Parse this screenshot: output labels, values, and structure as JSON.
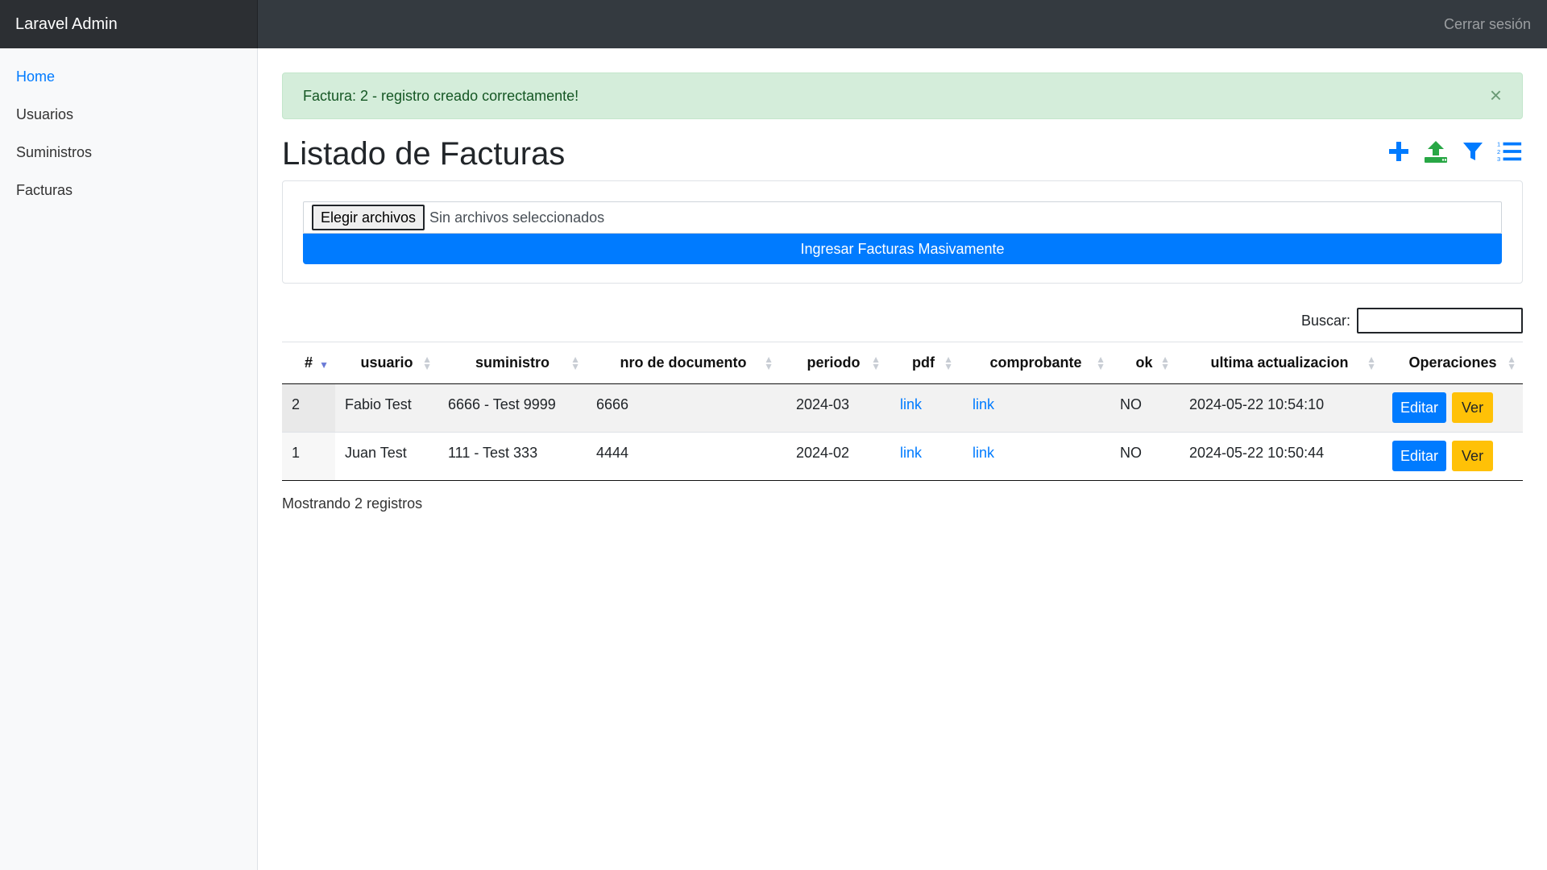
{
  "navbar": {
    "brand": "Laravel Admin",
    "logout": "Cerrar sesión"
  },
  "sidebar": {
    "items": [
      {
        "label": "Home",
        "active": true
      },
      {
        "label": "Usuarios"
      },
      {
        "label": "Suministros"
      },
      {
        "label": "Facturas"
      }
    ]
  },
  "alert": {
    "message": "Factura: 2 - registro creado correctamente!",
    "close": "×"
  },
  "page": {
    "title": "Listado de Facturas"
  },
  "toolbar": {
    "icons": [
      "plus-icon",
      "upload-icon",
      "filter-icon",
      "ordered-list-icon"
    ],
    "colors": {
      "plus": "#007bff",
      "upload": "#28a745",
      "filter": "#007bff",
      "list": "#007bff"
    }
  },
  "upload": {
    "button": "Elegir archivos",
    "status": "Sin archivos seleccionados",
    "submit": "Ingresar Facturas Masivamente"
  },
  "search": {
    "label": "Buscar:",
    "value": ""
  },
  "table": {
    "headers": [
      "#",
      "usuario",
      "suministro",
      "nro de documento",
      "periodo",
      "pdf",
      "comprobante",
      "ok",
      "ultima actualizacion",
      "Operaciones"
    ],
    "rows": [
      {
        "id": "2",
        "usuario": "Fabio Test",
        "suministro": "6666 - Test 9999",
        "nro": "6666",
        "periodo": "2024-03",
        "pdf": "link",
        "comprobante": "link",
        "ok": "NO",
        "actualizacion": "2024-05-22 10:54:10",
        "edit": "Editar",
        "view": "Ver"
      },
      {
        "id": "1",
        "usuario": "Juan Test",
        "suministro": "111 - Test 333",
        "nro": "4444",
        "periodo": "2024-02",
        "pdf": "link",
        "comprobante": "link",
        "ok": "NO",
        "actualizacion": "2024-05-22 10:50:44",
        "edit": "Editar",
        "view": "Ver"
      }
    ]
  },
  "footer": {
    "info": "Mostrando 2 registros"
  },
  "colors": {
    "primary": "#007bff",
    "warning": "#ffc107",
    "success_bg": "#d4edda",
    "navbar": "#343a40"
  }
}
